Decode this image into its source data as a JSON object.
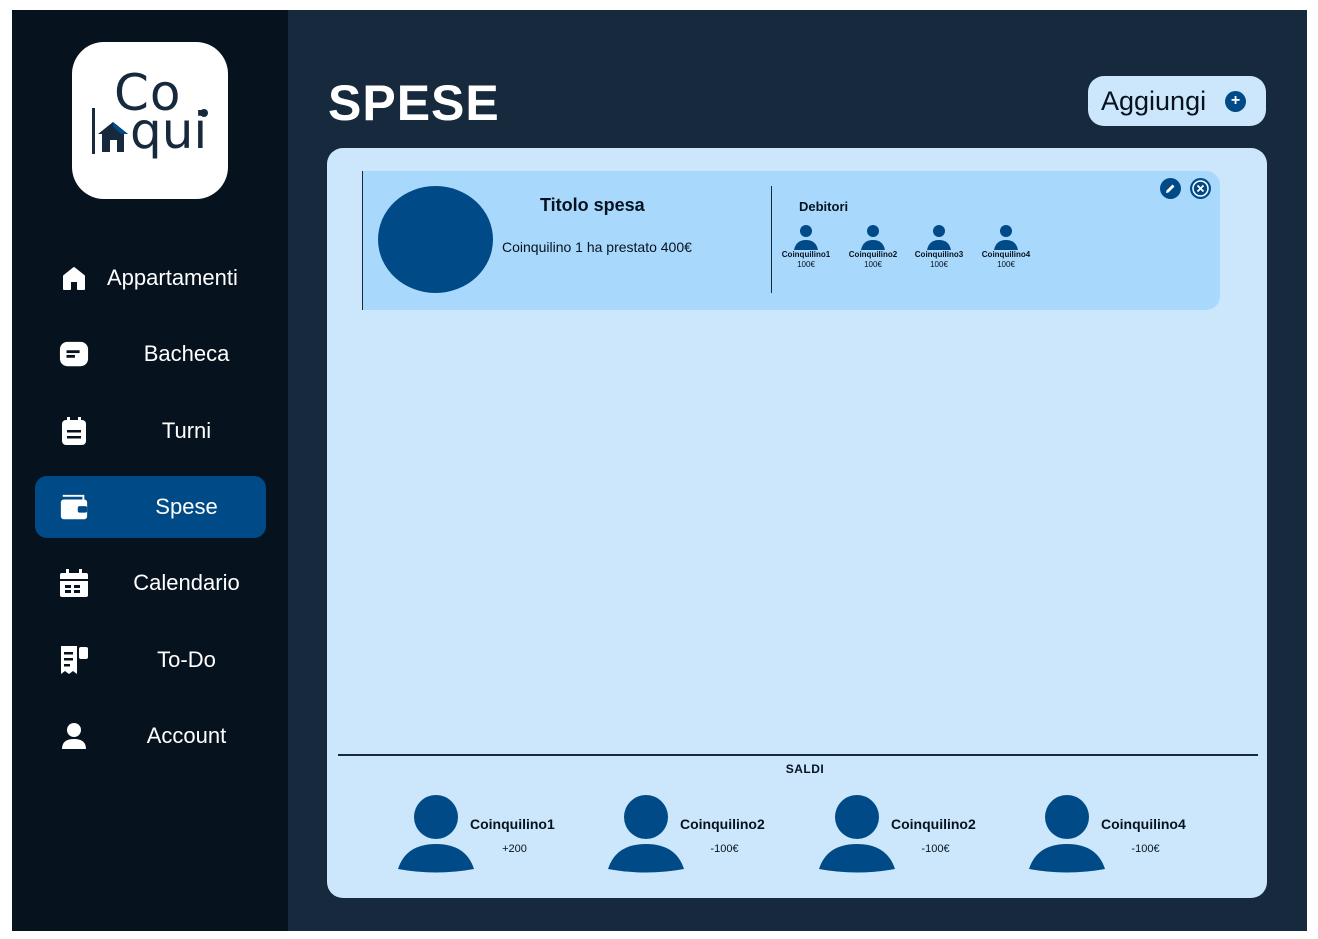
{
  "app": {
    "logo_text_top": "Co",
    "logo_text_bottom": "qui",
    "logo_icon": "house-icon",
    "colors": {
      "sidebar_bg": "#06131f",
      "main_bg": "#172a3d",
      "accent": "#004b87",
      "panel_bg": "#cce6fb",
      "card_bg": "#a9d8fd"
    }
  },
  "sidebar": {
    "items": [
      {
        "label": "Appartamenti",
        "icon": "home-icon",
        "active": false
      },
      {
        "label": "Bacheca",
        "icon": "message-icon",
        "active": false
      },
      {
        "label": "Turni",
        "icon": "clipboard-icon",
        "active": false
      },
      {
        "label": "Spese",
        "icon": "wallet-icon",
        "active": true
      },
      {
        "label": "Calendario",
        "icon": "calendar-icon",
        "active": false
      },
      {
        "label": "To-Do",
        "icon": "todo-list-icon",
        "active": false
      },
      {
        "label": "Account",
        "icon": "user-icon",
        "active": false
      }
    ]
  },
  "header": {
    "title": "SPESE",
    "add_label": "Aggiungi",
    "add_icon": "plus-circle-icon"
  },
  "expense": {
    "title": "Titolo spesa",
    "description": "Coinquilino 1 ha prestato 400€",
    "debtors_label": "Debitori",
    "debtors": [
      {
        "name": "Coinquilino1",
        "amount": "100€"
      },
      {
        "name": "Coinquilino2",
        "amount": "100€"
      },
      {
        "name": "Coinquilino3",
        "amount": "100€"
      },
      {
        "name": "Coinquilino4",
        "amount": "100€"
      }
    ],
    "edit_icon": "pencil-icon",
    "delete_icon": "close-icon"
  },
  "balances": {
    "title": "SALDI",
    "items": [
      {
        "name": "Coinquilino1",
        "amount": "+200"
      },
      {
        "name": "Coinquilino2",
        "amount": "-100€"
      },
      {
        "name": "Coinquilino2",
        "amount": "-100€"
      },
      {
        "name": "Coinquilino4",
        "amount": "-100€"
      }
    ]
  }
}
